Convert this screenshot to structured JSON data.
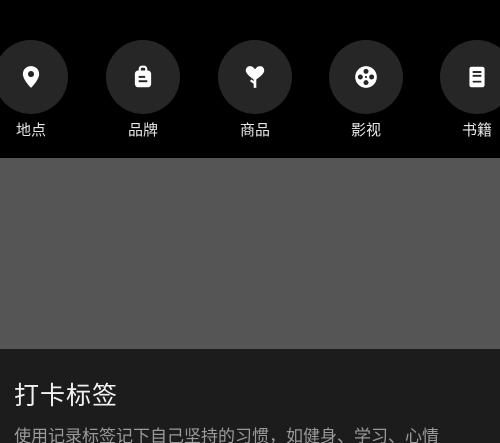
{
  "categories": [
    {
      "label": "地点",
      "icon": "location-pin-icon"
    },
    {
      "label": "品牌",
      "icon": "shopping-bag-icon"
    },
    {
      "label": "商品",
      "icon": "heart-tree-icon"
    },
    {
      "label": "影视",
      "icon": "film-reel-icon"
    },
    {
      "label": "书籍",
      "icon": "book-icon"
    }
  ],
  "card": {
    "title": "打卡标签",
    "description": "使用记录标签记下自己坚持的习惯，如健身、学习、心情"
  },
  "colors": {
    "background": "#000000",
    "icon_circle": "#262626",
    "placeholder_panel": "#555555",
    "card_background": "#1c1c1c",
    "label_text": "#e6e6e6",
    "title_text": "#f2f2f2",
    "description_text": "#9a9a9a"
  }
}
